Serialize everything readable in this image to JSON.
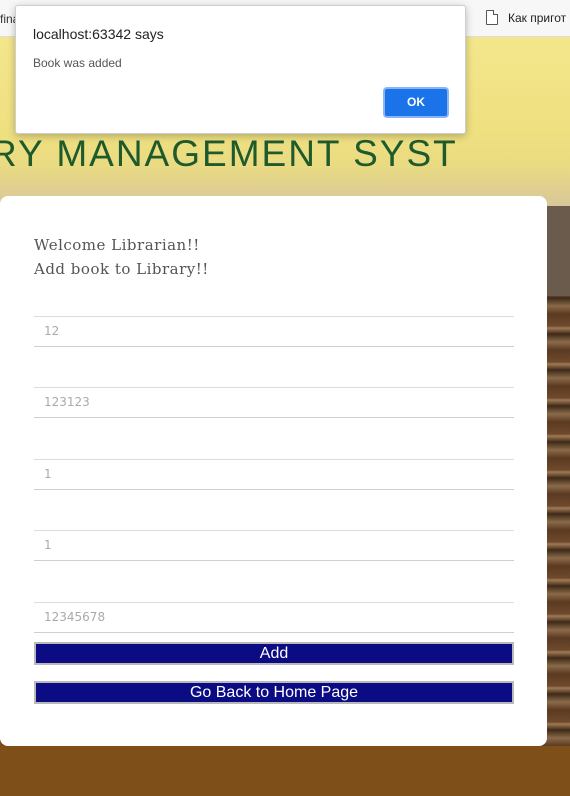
{
  "browser": {
    "bookmark_left": "fina",
    "bookmark_right": "Как пригот"
  },
  "header": {
    "title": "RY MANAGEMENT SYST"
  },
  "form": {
    "welcome_line1": "Welcome Librarian!!",
    "welcome_line2": "Add book to Library!!",
    "fields": [
      {
        "value": "12"
      },
      {
        "value": "123123"
      },
      {
        "value": "1"
      },
      {
        "value": "1"
      },
      {
        "value": "12345678"
      }
    ],
    "add_label": "Add",
    "back_label": "Go Back to Home Page",
    "button_color": "#0b0b83"
  },
  "dialog": {
    "title": "localhost:63342 says",
    "message": "Book was added",
    "ok_label": "OK",
    "ok_color": "#1a73e8"
  }
}
